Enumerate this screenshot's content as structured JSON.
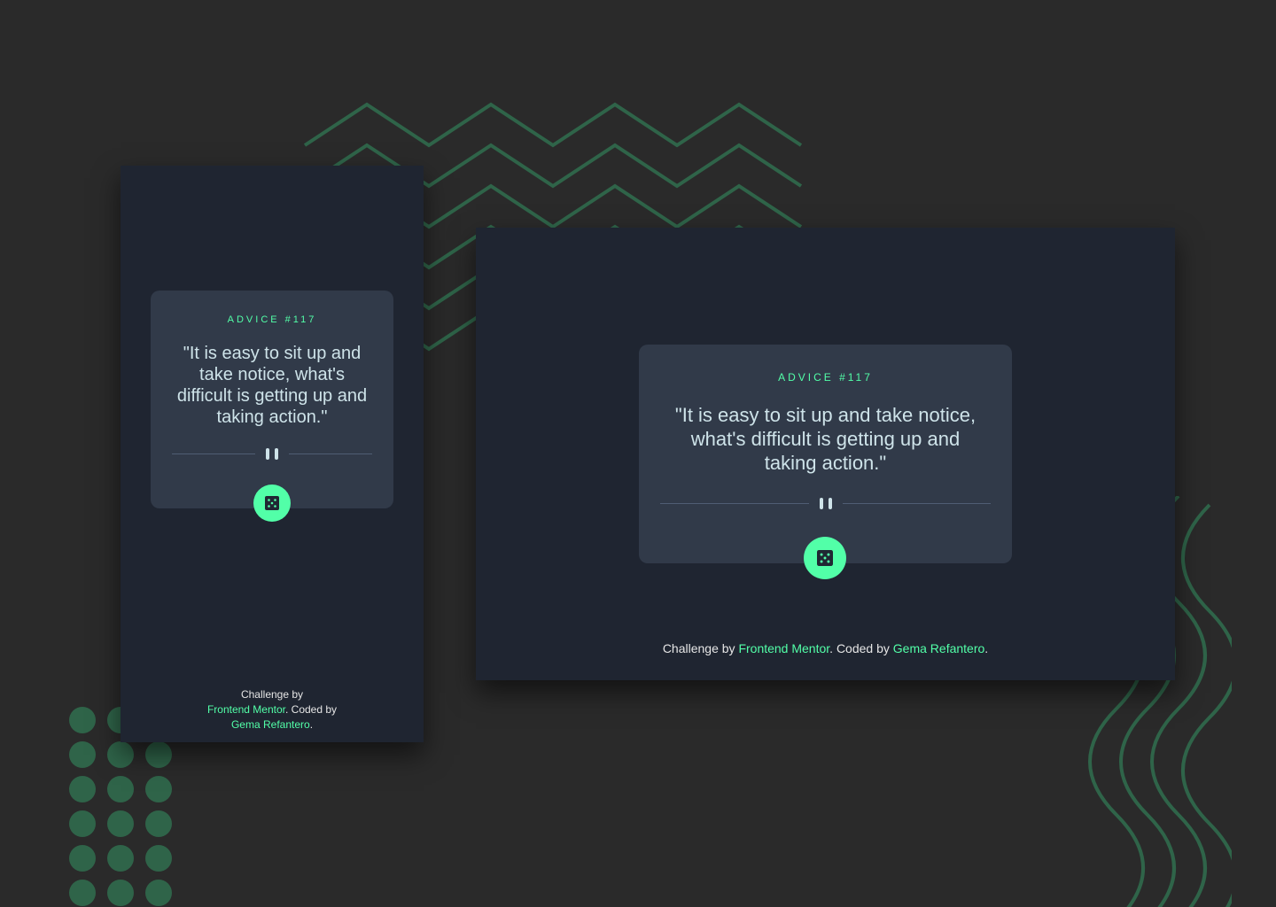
{
  "colors": {
    "background": "#2a2a2a",
    "frame": "#1f2531",
    "card": "#313a49",
    "accent": "#52ffa8",
    "quote_text": "#cee3e9",
    "divider": "#4f5d74",
    "decoration": "#2f6449"
  },
  "mobile": {
    "advice_label": "ADVICE #117",
    "quote": "\"It is easy to sit up and take notice, what's difficult is getting up and taking action.\"",
    "divider_icon": "pause-icon",
    "button_icon": "dice-icon",
    "footer": {
      "prefix": "Challenge by",
      "link1": "Frontend Mentor",
      "middle": ". Coded by",
      "link2": "Gema Refantero",
      "suffix": "."
    }
  },
  "desktop": {
    "advice_label": "ADVICE #117",
    "quote": "\"It is easy to sit up and take notice, what's difficult is getting up and taking action.\"",
    "divider_icon": "pause-icon",
    "button_icon": "dice-icon",
    "footer": {
      "prefix": "Challenge by",
      "link1": "Frontend Mentor",
      "middle": ". Coded by",
      "link2": "Gema Refantero",
      "suffix": "."
    }
  }
}
